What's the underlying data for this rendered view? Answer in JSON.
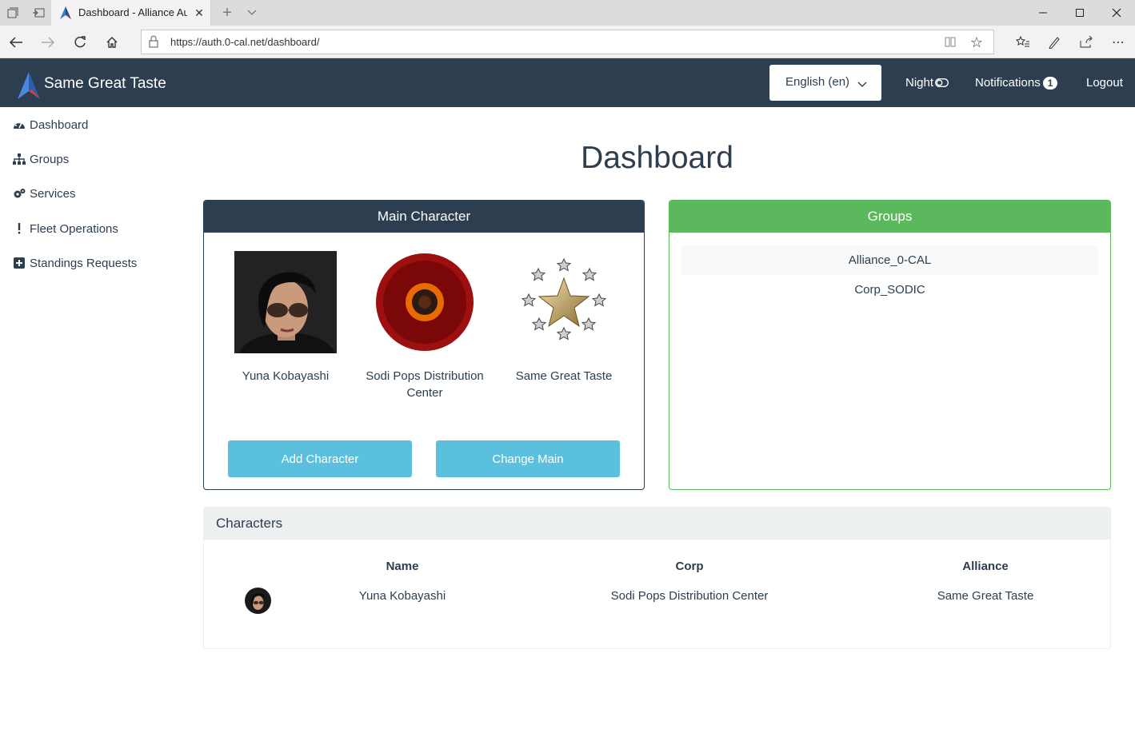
{
  "browser": {
    "tab_title": "Dashboard - Alliance Au",
    "url": "https://auth.0-cal.net/dashboard/"
  },
  "navbar": {
    "brand": "Same Great Taste",
    "language": "English (en)",
    "night": "Night",
    "notifications": "Notifications",
    "notifications_count": "1",
    "logout": "Logout"
  },
  "sidebar": {
    "items": [
      {
        "label": "Dashboard",
        "icon": "dashboard-icon"
      },
      {
        "label": "Groups",
        "icon": "sitemap-icon"
      },
      {
        "label": "Services",
        "icon": "cogs-icon"
      },
      {
        "label": "Fleet Operations",
        "icon": "exclamation-icon"
      },
      {
        "label": "Standings Requests",
        "icon": "plus-square-icon"
      }
    ]
  },
  "main": {
    "title": "Dashboard",
    "main_character": {
      "heading": "Main Character",
      "character": "Yuna Kobayashi",
      "corp": "Sodi Pops Distribution Center",
      "alliance": "Same Great Taste",
      "add_button": "Add Character",
      "change_button": "Change Main"
    },
    "groups": {
      "heading": "Groups",
      "items": [
        "Alliance_0-CAL",
        "Corp_SODIC"
      ]
    },
    "characters": {
      "heading": "Characters",
      "columns": [
        "Name",
        "Corp",
        "Alliance"
      ],
      "rows": [
        {
          "name": "Yuna Kobayashi",
          "corp": "Sodi Pops Distribution Center",
          "alliance": "Same Great Taste"
        }
      ]
    }
  },
  "colors": {
    "navbar": "#2c3e50",
    "groups_accent": "#5cb85c",
    "button_info": "#5bc0de"
  }
}
